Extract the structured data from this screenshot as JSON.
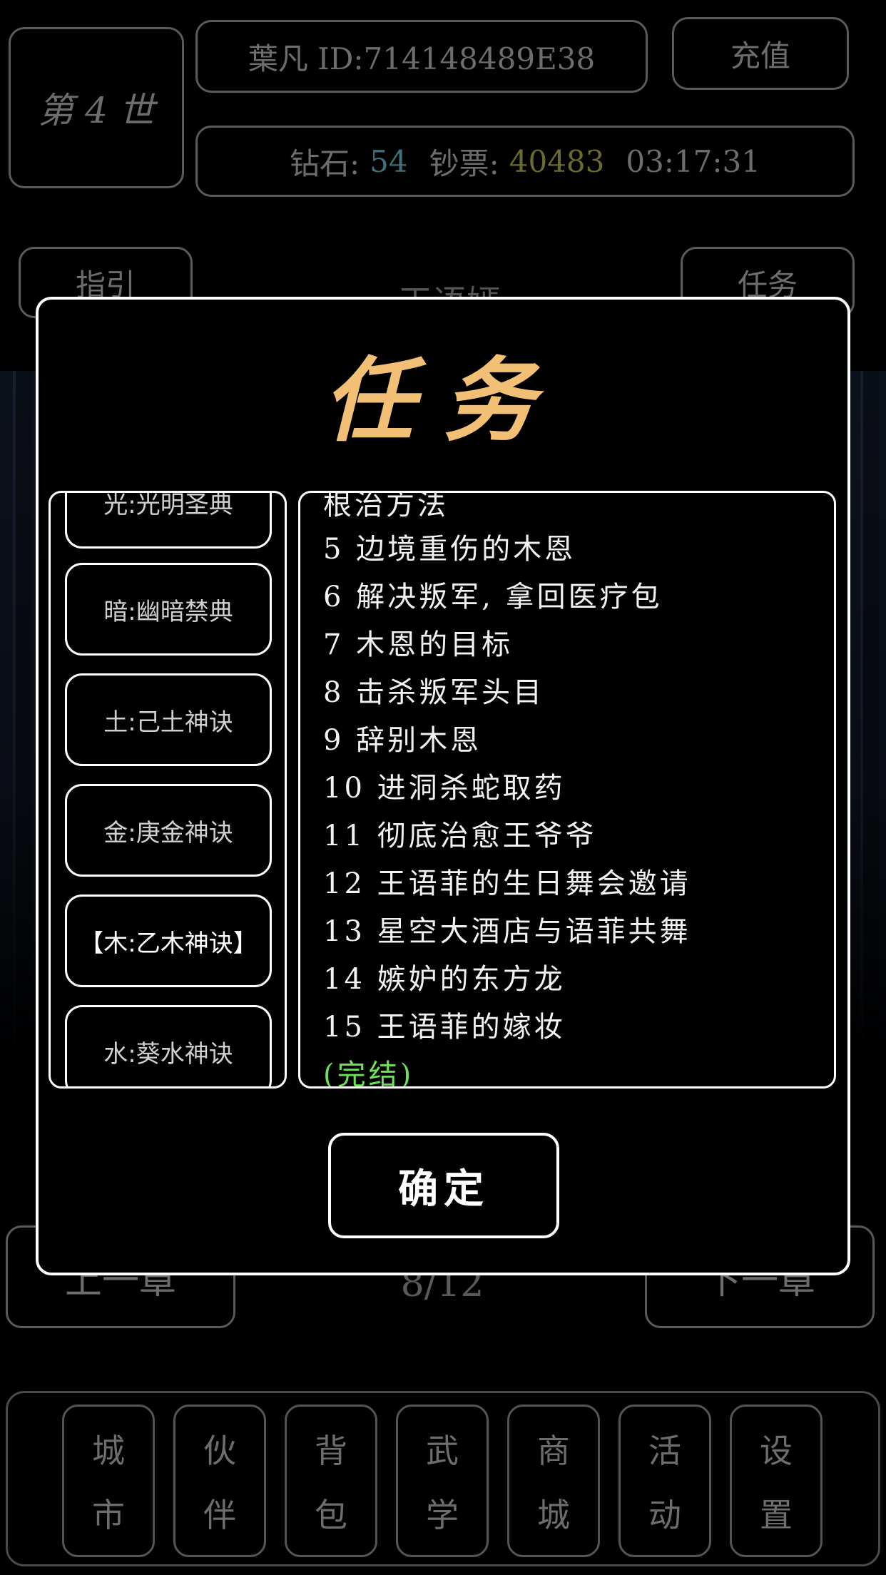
{
  "header": {
    "generation": "第 4 世",
    "player_id": "葉凡 ID:714148489E38",
    "recharge": "充值",
    "diamond_label": "钻石:",
    "diamond_value": "54",
    "cash_label": "钞票:",
    "cash_value": "40483",
    "time": "03:17:31"
  },
  "toolbar": {
    "guide": "指引",
    "task": "任务",
    "chapter_title": "王语嫣"
  },
  "chapter_nav": {
    "prev": "上一章",
    "page": "8/12",
    "next": "下一章"
  },
  "bottom_nav": [
    {
      "top": "城",
      "bottom": "市"
    },
    {
      "top": "伙",
      "bottom": "伴"
    },
    {
      "top": "背",
      "bottom": "包"
    },
    {
      "top": "武",
      "bottom": "学"
    },
    {
      "top": "商",
      "bottom": "城"
    },
    {
      "top": "活",
      "bottom": "动"
    },
    {
      "top": "设",
      "bottom": "置"
    }
  ],
  "modal": {
    "title": "任务",
    "categories": [
      "光:光明圣典",
      "暗:幽暗禁典",
      "土:己土神诀",
      "金:庚金神诀",
      "【木:乙木神诀】",
      "水:葵水神诀"
    ],
    "quests": [
      "   根治方法",
      "5 边境重伤的木恩",
      "6 解决叛军, 拿回医疗包",
      "7 木恩的目标",
      "8 击杀叛军头目",
      "9 辞别木恩",
      "10 进洞杀蛇取药",
      "11 彻底治愈王爷爷",
      "12 王语菲的生日舞会邀请",
      "13 星空大酒店与语菲共舞",
      "14 嫉妒的东方龙",
      "15 王语菲的嫁妆",
      "(完结)"
    ],
    "confirm": "确定"
  }
}
